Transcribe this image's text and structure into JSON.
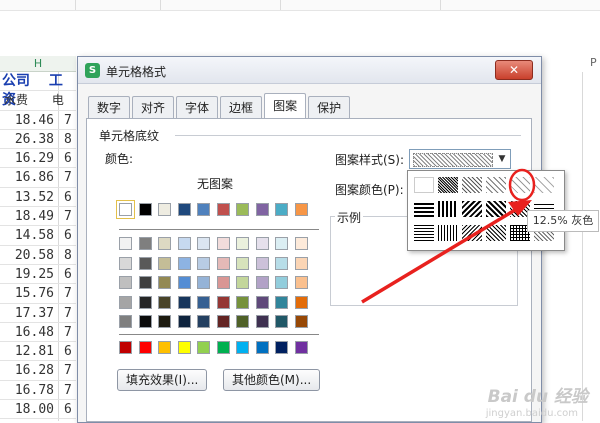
{
  "sheet": {
    "column_headers": [
      "H",
      "P"
    ],
    "header_row_1": [
      "公司",
      "工资"
    ],
    "header_row_2": [
      "水费",
      "电"
    ],
    "values": [
      "18.46",
      "26.38",
      "16.29",
      "16.86",
      "13.52",
      "18.49",
      "14.58",
      "20.58",
      "19.25",
      "15.76",
      "17.37",
      "16.48",
      "12.81",
      "16.28",
      "16.78",
      "18.00"
    ],
    "second_col_digits": [
      "7",
      "8",
      "6",
      "7",
      "6",
      "7",
      "6",
      "8",
      "6",
      "7",
      "7",
      "7",
      "6",
      "7",
      "7",
      "6"
    ]
  },
  "dialog": {
    "title": "单元格格式",
    "app_icon": "S",
    "close": "✕",
    "tabs": [
      "数字",
      "对齐",
      "字体",
      "边框",
      "图案",
      "保护"
    ],
    "active_tab": "图案",
    "section": "单元格底纹",
    "color_label": "颜色:",
    "no_pattern": "无图案",
    "fill_effects_button": "填充效果(I)...",
    "more_colors_button": "其他颜色(M)...",
    "pattern_style_label": "图案样式(S):",
    "pattern_color_label": "图案颜色(P):",
    "example_label": "示例"
  },
  "swatches": {
    "top_row": [
      "#ffffff",
      "#000000",
      "#eeece1",
      "#1f497d",
      "#4f81bd",
      "#c0504d",
      "#9bbb59",
      "#8064a2",
      "#4bacc6",
      "#f79646"
    ],
    "tints": [
      [
        "#f2f2f2",
        "#7f7f7f",
        "#ddd9c3",
        "#c6d9f0",
        "#dbe5f1",
        "#f2dcdb",
        "#ebf1dd",
        "#e5e0ec",
        "#dbeef3",
        "#fdeada"
      ],
      [
        "#d8d8d8",
        "#595959",
        "#c4bd97",
        "#8db3e2",
        "#b8cce4",
        "#e5b9b7",
        "#d7e3bc",
        "#ccc1d9",
        "#b7dde8",
        "#fbd5b5"
      ],
      [
        "#bfbfbf",
        "#3f3f3f",
        "#938953",
        "#548dd4",
        "#95b3d7",
        "#d99694",
        "#c3d69b",
        "#b2a2c7",
        "#92cddc",
        "#fac08f"
      ],
      [
        "#a5a5a5",
        "#262626",
        "#494429",
        "#17365d",
        "#366092",
        "#953734",
        "#76923c",
        "#5f497a",
        "#31859b",
        "#e36c09"
      ],
      [
        "#7f7f7f",
        "#0c0c0c",
        "#1d1b10",
        "#0f243e",
        "#244061",
        "#632423",
        "#4f6128",
        "#3f3151",
        "#205867",
        "#974806"
      ]
    ],
    "standard": [
      "#c00000",
      "#ff0000",
      "#ffc000",
      "#ffff00",
      "#92d050",
      "#00b050",
      "#00b0f0",
      "#0070c0",
      "#002060",
      "#7030a0"
    ]
  },
  "pattern_popup": {
    "tooltip": "12.5% 灰色",
    "highlight_color": "#e8211e"
  },
  "watermark": {
    "brand": "Bai du 经验",
    "url": "jingyan.baidu.com"
  }
}
